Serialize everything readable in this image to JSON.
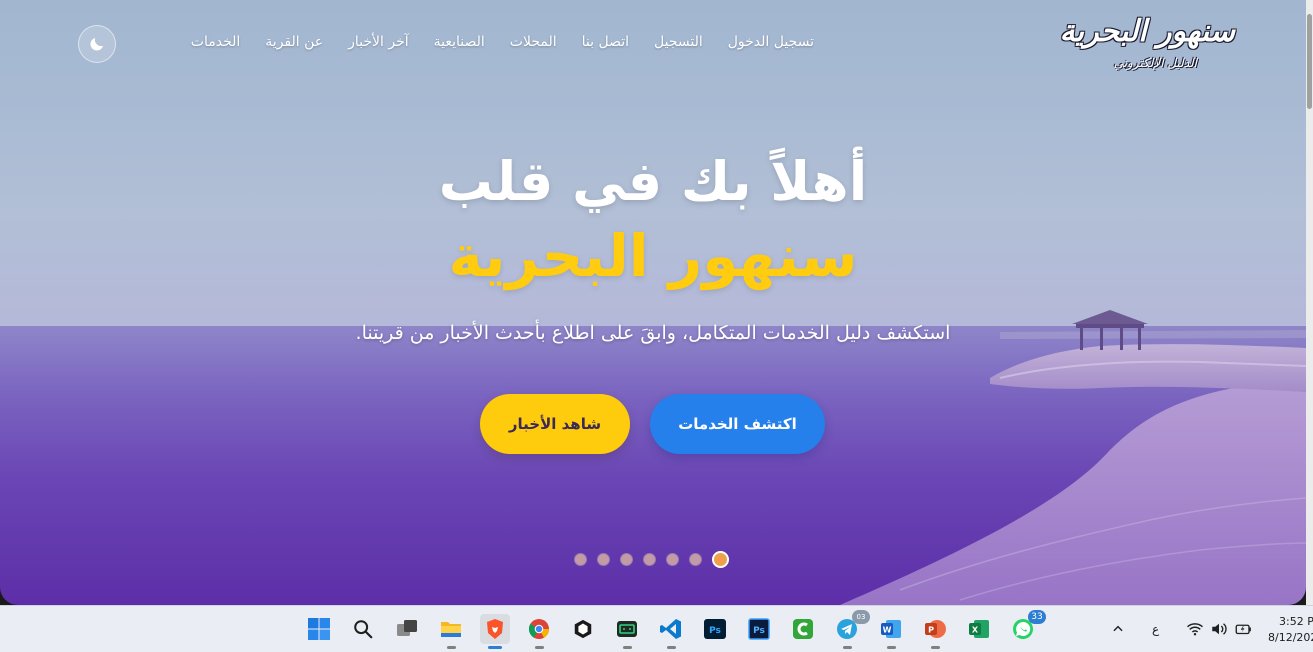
{
  "brand": {
    "logo_main": "سنهور البحرية",
    "logo_sub": "الدليل الإلكتروني"
  },
  "nav": {
    "items": [
      {
        "label": "الخدمات"
      },
      {
        "label": "عن القرية"
      },
      {
        "label": "آخر الأخبار"
      },
      {
        "label": "الصنايعية"
      },
      {
        "label": "المحلات"
      },
      {
        "label": "اتصل بنا"
      },
      {
        "label": "التسجيل"
      },
      {
        "label": "تسجيل الدخول"
      }
    ],
    "theme_toggle_icon": "moon-icon"
  },
  "hero": {
    "title_line1": "أهلاً بك في قلب",
    "title_line2": "سنهور البحرية",
    "subtitle": "استكشف دليل الخدمات المتكامل، وابقَ على اطلاع بأحدث الأخبار من قريتنا.",
    "primary_button": "اكتشف الخدمات",
    "secondary_button": "شاهد الأخبار",
    "slides_count": 7,
    "active_slide": 7
  },
  "colors": {
    "accent_yellow": "#ffcc10",
    "button_blue": "#2680ec",
    "active_dot": "#f0a04a"
  },
  "taskbar": {
    "apps": [
      {
        "icon": "windows-start-icon"
      },
      {
        "icon": "search-icon"
      },
      {
        "icon": "task-view-icon"
      },
      {
        "icon": "file-explorer-icon"
      },
      {
        "icon": "brave-browser-icon"
      },
      {
        "icon": "chrome-icon"
      },
      {
        "icon": "app-box-icon"
      },
      {
        "icon": "terminal-app-icon"
      },
      {
        "icon": "vscode-icon"
      },
      {
        "icon": "photoshop-icon"
      },
      {
        "icon": "photoshop-alt-icon"
      },
      {
        "icon": "camtasia-icon"
      },
      {
        "icon": "telegram-icon",
        "badge": "03"
      },
      {
        "icon": "word-icon"
      },
      {
        "icon": "powerpoint-icon"
      },
      {
        "icon": "excel-icon"
      },
      {
        "icon": "whatsapp-icon",
        "badge": "33"
      }
    ],
    "tray": {
      "language": "ع",
      "time": "3:52 P",
      "date": "8/12/202"
    }
  }
}
